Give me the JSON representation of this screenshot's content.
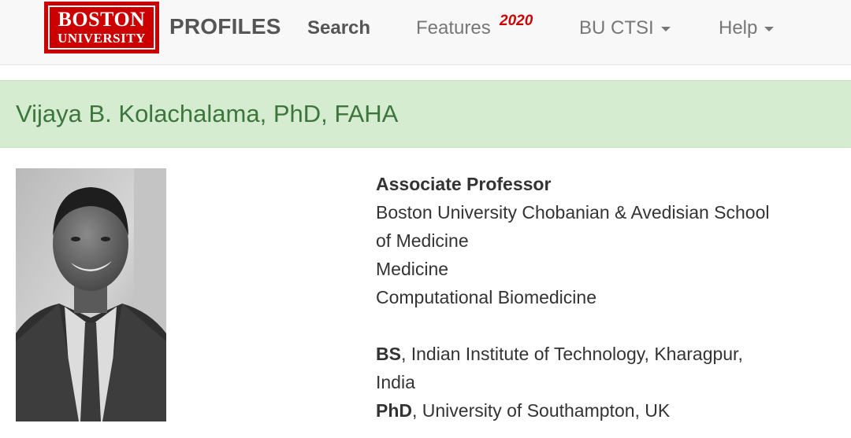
{
  "logo": {
    "line1": "BOSTON",
    "line2": "UNIVERSITY"
  },
  "nav": {
    "brand": "PROFILES",
    "search": "Search",
    "features": "Features",
    "features_badge": "2020",
    "ctsi": "BU CTSI",
    "help": "Help",
    "badge_color": "#cc0000"
  },
  "profile": {
    "name": "Vijaya B. Kolachalama, PhD, FAHA",
    "title": "Associate Professor",
    "school_line1": "Boston University Chobanian & Avedisian School",
    "school_line2": "of Medicine",
    "department": "Medicine",
    "division": "Computational Biomedicine",
    "education": [
      {
        "degree": "BS",
        "institution": ", Indian Institute of Technology, Kharagpur,",
        "institution_cont": "India"
      },
      {
        "degree": "PhD",
        "institution": ", University of Southampton, UK"
      }
    ]
  },
  "colors": {
    "name_bar": "#d6ecd1",
    "name_text": "#3c763d",
    "logo_red": "#cc0000"
  }
}
